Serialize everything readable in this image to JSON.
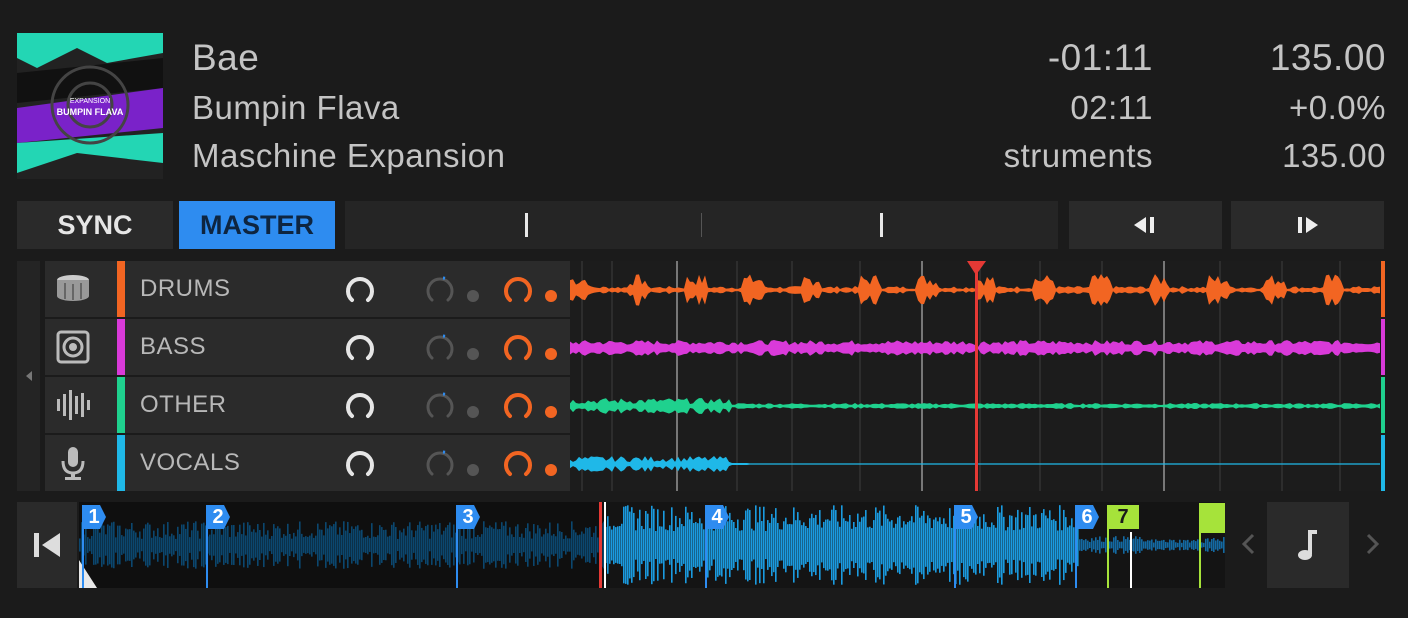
{
  "track": {
    "title": "Bae",
    "artist": "Bumpin Flava",
    "album": "Maschine Expansion",
    "remaining_time": "-01:11",
    "elapsed_time": "02:11",
    "scroll_text": "struments",
    "bpm": "135.00",
    "pitch": "+0.0%",
    "tempo": "135.00"
  },
  "buttons": {
    "sync": "SYNC",
    "master": "MASTER"
  },
  "stems": [
    {
      "label": "DRUMS",
      "color": "#f26522",
      "icon": "drum-icon"
    },
    {
      "label": "BASS",
      "color": "#d93ad9",
      "icon": "speaker-icon"
    },
    {
      "label": "OTHER",
      "color": "#1fd18e",
      "icon": "waveform-icon"
    },
    {
      "label": "VOCALS",
      "color": "#1fb8e8",
      "icon": "microphone-icon"
    }
  ],
  "cues": [
    "1",
    "2",
    "3",
    "4",
    "5",
    "6",
    "7"
  ],
  "colors": {
    "accent": "#2e8cf0",
    "playhead": "#e53935",
    "loop": "#a6e33a",
    "overview_wave": "#1a9be0"
  },
  "icons": {
    "cue_back": "skip-to-start-icon",
    "beatjump_back": "beatjump-back-icon",
    "beatjump_forward": "beatjump-forward-icon",
    "note": "music-note-icon",
    "prev": "chevron-left-icon",
    "next": "chevron-right-icon",
    "collapse": "triangle-left-icon"
  }
}
